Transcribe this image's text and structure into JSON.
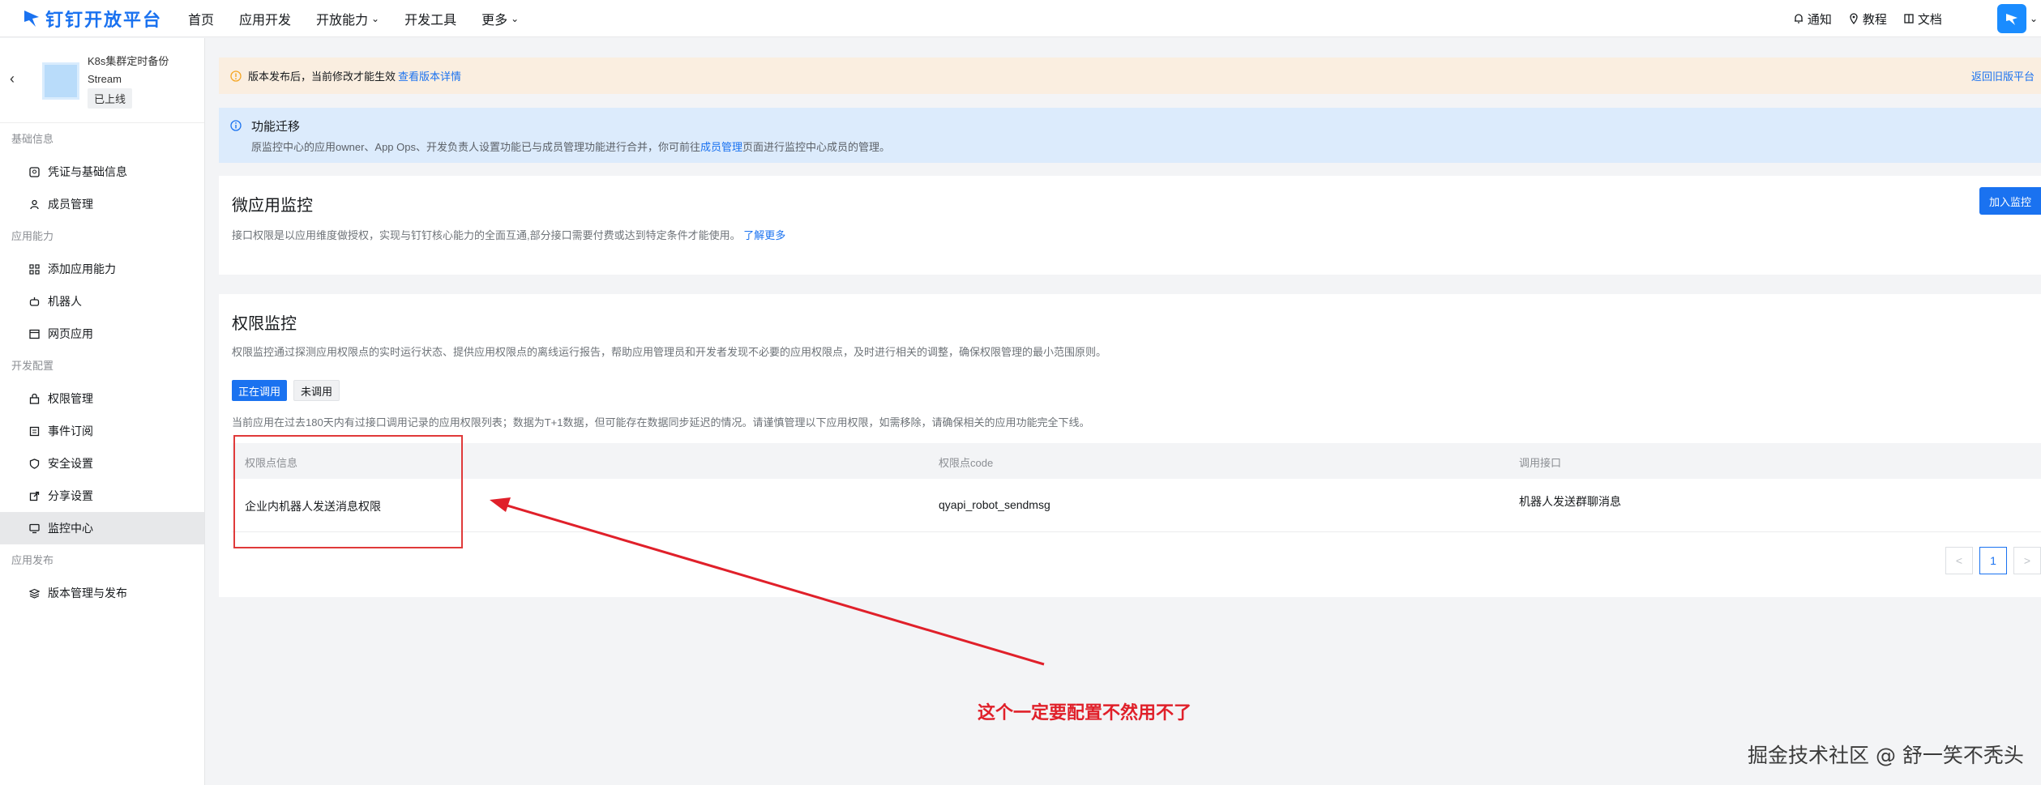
{
  "topbar": {
    "logo_text": "钉钉开放平台",
    "nav": [
      {
        "label": "首页",
        "dropdown": false
      },
      {
        "label": "应用开发",
        "dropdown": false
      },
      {
        "label": "开放能力",
        "dropdown": true
      },
      {
        "label": "开发工具",
        "dropdown": false
      },
      {
        "label": "更多",
        "dropdown": true
      }
    ],
    "notify": "通知",
    "tutorial": "教程",
    "docs": "文档"
  },
  "sidebar": {
    "app_name": "K8s集群定时备份Stream",
    "app_status": "已上线",
    "groups": [
      {
        "label": "基础信息",
        "items": [
          {
            "label": "凭证与基础信息",
            "icon": "credential-icon"
          },
          {
            "label": "成员管理",
            "icon": "user-icon"
          }
        ]
      },
      {
        "label": "应用能力",
        "items": [
          {
            "label": "添加应用能力",
            "icon": "grid-icon"
          },
          {
            "label": "机器人",
            "icon": "robot-icon"
          },
          {
            "label": "网页应用",
            "icon": "webpage-icon"
          }
        ]
      },
      {
        "label": "开发配置",
        "items": [
          {
            "label": "权限管理",
            "icon": "lock-icon"
          },
          {
            "label": "事件订阅",
            "icon": "event-icon"
          },
          {
            "label": "安全设置",
            "icon": "shield-icon"
          },
          {
            "label": "分享设置",
            "icon": "share-icon"
          },
          {
            "label": "监控中心",
            "icon": "monitor-icon",
            "active": true
          }
        ]
      },
      {
        "label": "应用发布",
        "items": [
          {
            "label": "版本管理与发布",
            "icon": "layers-icon"
          }
        ]
      }
    ]
  },
  "banner_warn": {
    "text": "版本发布后，当前修改才能生效",
    "link": "查看版本详情",
    "right_link": "返回旧版平台"
  },
  "banner_info": {
    "title": "功能迁移",
    "desc_before": "原监控中心的应用owner、App Ops、开发负责人设置功能已与成员管理功能进行合并，你可前往",
    "desc_link": "成员管理",
    "desc_after": "页面进行监控中心成员的管理。"
  },
  "micro_monitor": {
    "title": "微应用监控",
    "desc": "接口权限是以应用维度做授权，实现与钉钉核心能力的全面互通,部分接口需要付费或达到特定条件才能使用。",
    "link": "了解更多",
    "join_button": "加入监控"
  },
  "perm_monitor": {
    "title": "权限监控",
    "desc": "权限监控通过探测应用权限点的实时运行状态、提供应用权限点的离线运行报告，帮助应用管理员和开发者发现不必要的应用权限点，及时进行相关的调整，确保权限管理的最小范围原则。",
    "tabs": [
      "正在调用",
      "未调用"
    ],
    "note": "当前应用在过去180天内有过接口调用记录的应用权限列表；数据为T+1数据，但可能存在数据同步延迟的情况。请谨慎管理以下应用权限，如需移除，请确保相关的应用功能完全下线。",
    "columns": [
      "权限点信息",
      "权限点code",
      "调用接口"
    ],
    "rows": [
      [
        "企业内机器人发送消息权限",
        "qyapi_robot_sendmsg",
        "机器人发送群聊消息"
      ]
    ],
    "page_current": "1",
    "page_prev": "<",
    "page_next": ">"
  },
  "annotation": "这个一定要配置不然用不了",
  "watermark": "掘金技术社区 @ 舒一笑不秃头",
  "colors": {
    "accent": "#1a72f0",
    "annotation": "#e0202a",
    "warn_bg": "#faeee0",
    "info_bg": "#dcebfc"
  }
}
